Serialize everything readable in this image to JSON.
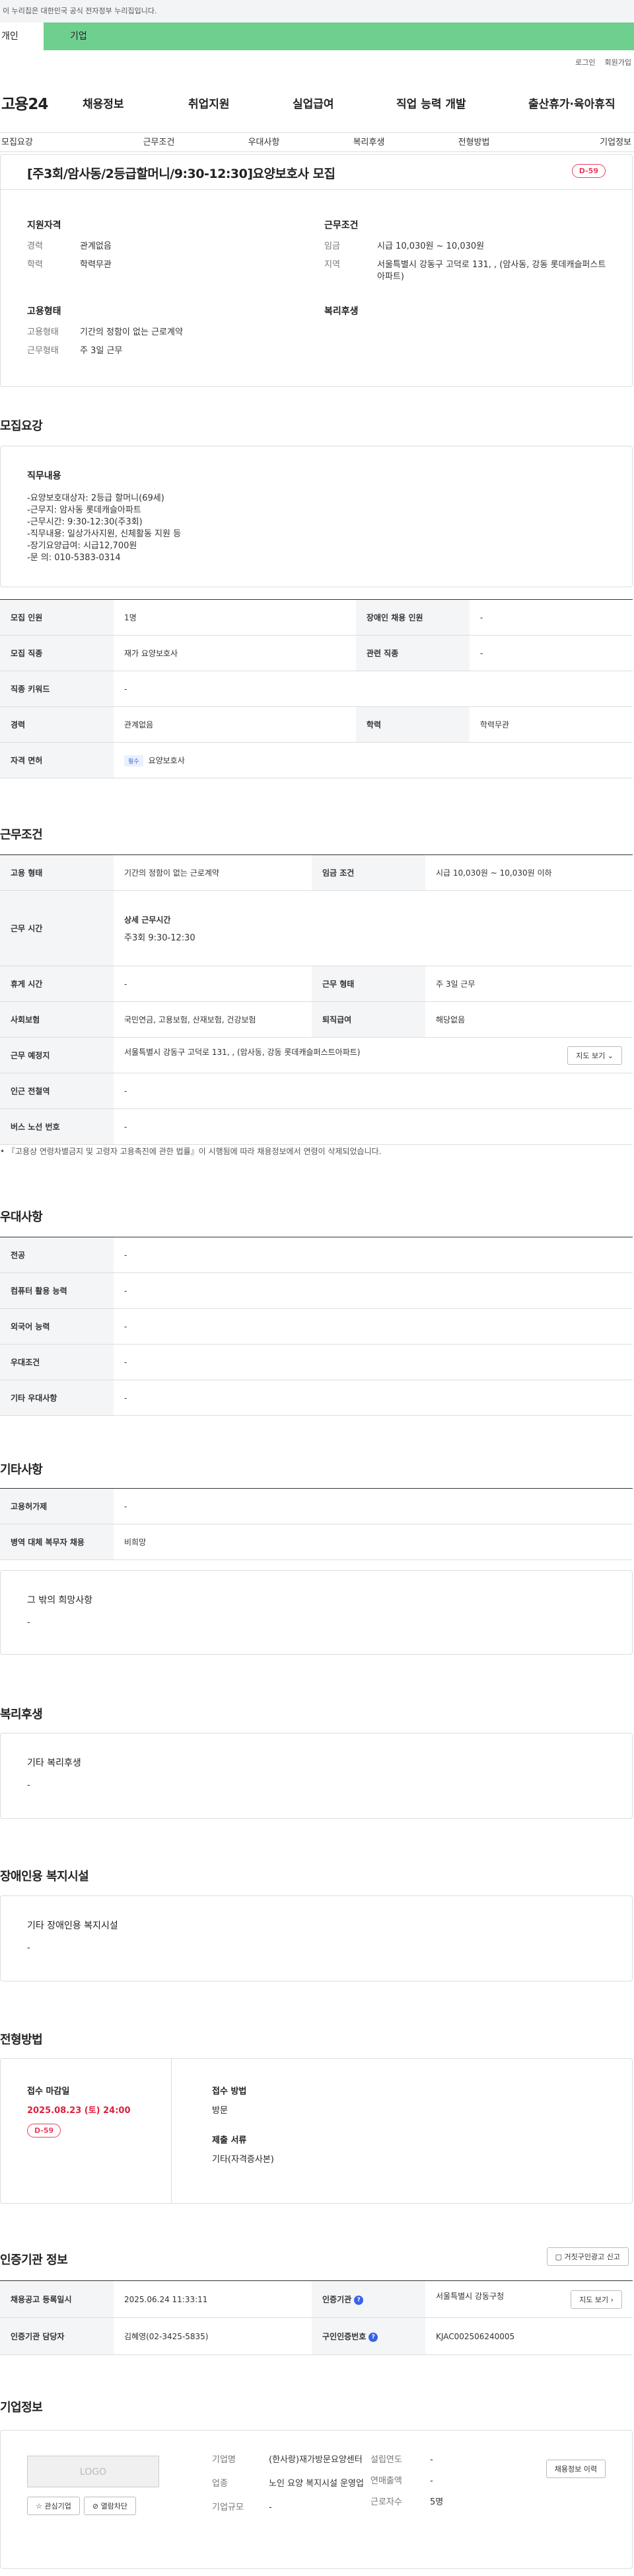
{
  "topbar": {
    "notice": "이 누리집은 대한민국 공식 전자정부 누리집입니다."
  },
  "tabs": {
    "personal": "개인",
    "company": "기업"
  },
  "util": {
    "login": "로그인",
    "join": "회원가입"
  },
  "gnb": {
    "logo": "고용24",
    "menu": [
      "채용정보",
      "취업지원",
      "실업급여",
      "직업 능력 개발",
      "출산휴가·육아휴직"
    ]
  },
  "subnav": [
    "모집요강",
    "근무조건",
    "우대사항",
    "복리후생",
    "전형방법",
    "기업정보"
  ],
  "job": {
    "title": "[주3회/암사동/2등급할머니/9:30-12:30]요양보호사 모집",
    "dday": "D-59",
    "qual_title": "지원자격",
    "qual": [
      {
        "k": "경력",
        "v": "관계없음"
      },
      {
        "k": "학력",
        "v": "학력무관"
      }
    ],
    "cond_title": "근무조건",
    "cond": [
      {
        "k": "임금",
        "v": "시급 10,030원 ~ 10,030원"
      },
      {
        "k": "지역",
        "v": "서울특별시 강동구 고덕로 131, , (암사동, 강동 롯데캐슬퍼스트아파트)"
      }
    ],
    "emp_title": "고용형태",
    "emp": [
      {
        "k": "고용형태",
        "v": "기간의 정함이 없는 근로계약"
      },
      {
        "k": "근무형태",
        "v": "주 3일 근무"
      }
    ],
    "welfare_title": "복리후생"
  },
  "recruit": {
    "section": "모집요강",
    "duty_title": "직무내용",
    "duty_lines": [
      "-요양보호대상자: 2등급 할머니(69세)",
      "-근무지: 암사동 롯데캐슬아파트",
      "-근무시간: 9:30-12:30(주3회)",
      "-직무내용: 일상가사지원, 신체활동 지원 등",
      "-장기요양급여: 시급12,700원",
      "-문 의: 010-5383-0314"
    ],
    "rows": [
      {
        "h1": "모집 인원",
        "v1": "1명",
        "h2": "장애인 채용 인원",
        "v2": "-"
      },
      {
        "h1": "모집 직종",
        "v1": "재가 요양보호사",
        "h2": "관련 직종",
        "v2": "-"
      },
      {
        "h1": "직종 키워드",
        "v1": "-"
      },
      {
        "h1": "경력",
        "v1": "관계없음",
        "h2": "학력",
        "v2": "학력무관"
      },
      {
        "h1": "자격 면허",
        "badge": "필수",
        "v1": "요양보호사"
      }
    ]
  },
  "work": {
    "section": "근무조건",
    "rows": [
      {
        "h1": "고용 형태",
        "v1": "기간의 정함이 없는 근로계약",
        "h2": "임금 조건",
        "v2": "시급 10,030원 ~ 10,030원 이하"
      },
      {
        "h1": "근무 시간",
        "sub": "상세 근무시간",
        "v1": "주3회 9:30-12:30"
      },
      {
        "h1": "휴게 시간",
        "v1": "-",
        "h2": "근무 형태",
        "v2": "주 3일 근무"
      },
      {
        "h1": "사회보험",
        "v1": "국민연금, 고용보험, 산재보험, 건강보험",
        "h2": "퇴직급여",
        "v2": "해당없음"
      },
      {
        "h1": "근무 예정지",
        "v1": "서울특별시 강동구 고덕로 131, , (암사동, 강동 롯데캐슬퍼스트아파트)",
        "btn": "지도 보기"
      },
      {
        "h1": "인근 전철역",
        "v1": "-"
      },
      {
        "h1": "버스 노선 번호",
        "v1": "-"
      }
    ],
    "note": "『고용상 연령차별금지 및 고령자 고용촉진에 관한 법률』이 시행됨에 따라 채용정보에서 연령이 삭제되었습니다."
  },
  "pref": {
    "section": "우대사항",
    "rows": [
      {
        "h": "전공",
        "v": "-"
      },
      {
        "h": "컴퓨터 활용 능력",
        "v": "-"
      },
      {
        "h": "외국어 능력",
        "v": "-"
      },
      {
        "h": "우대조건",
        "v": "-"
      },
      {
        "h": "기타 우대사항",
        "v": "-"
      }
    ]
  },
  "etc": {
    "section": "기타사항",
    "rows": [
      {
        "h": "고용허가제",
        "v": "-"
      },
      {
        "h": "병역 대체 복무자 채용",
        "v": "비희망"
      }
    ],
    "box_title": "그 밖의 희망사항",
    "box_text": "-"
  },
  "welfare": {
    "section": "복리후생",
    "box_title": "기타 복리후생",
    "box_text": "-"
  },
  "disabled": {
    "section": "장애인용 복지시설",
    "box_title": "기타 장애인용 복지시설",
    "box_text": "-"
  },
  "selection": {
    "section": "전형방법",
    "deadline_label": "접수 마감일",
    "deadline": "2025.08.23 (토) 24:00",
    "dday": "D-59",
    "method_label": "접수 방법",
    "method": "방문",
    "docs_label": "제출 서류",
    "docs": "기타(자격증사본)"
  },
  "agency": {
    "section": "인증기관 정보",
    "report_btn": "거짓구인광고 신고",
    "rows": [
      {
        "h1": "채용공고 등록일시",
        "v1": "2025.06.24 11:33:11",
        "h2": "인증기관",
        "v2": "서울특별시 강동구청",
        "btn": "지도 보기"
      },
      {
        "h1": "인증기관 담당자",
        "v1": "김혜영(02-3425-5835)",
        "h2": "구인인증번호",
        "v2": "KJAC002506240005"
      }
    ]
  },
  "company": {
    "section": "기업정보",
    "logo": "LOGO",
    "fav_btn": "관심기업",
    "block_btn": "열람차단",
    "info": [
      {
        "k": "기업명",
        "v": "(한사랑)재가방문요양센터"
      },
      {
        "k": "업종",
        "v": "노인 요양 복지시설 운영업"
      },
      {
        "k": "기업규모",
        "v": "-"
      }
    ],
    "info2": [
      {
        "k": "설립연도",
        "v": "-"
      },
      {
        "k": "연매출액",
        "v": "-"
      },
      {
        "k": "근로자수",
        "v": "5명"
      }
    ],
    "history_btn": "채용정보 이력"
  }
}
